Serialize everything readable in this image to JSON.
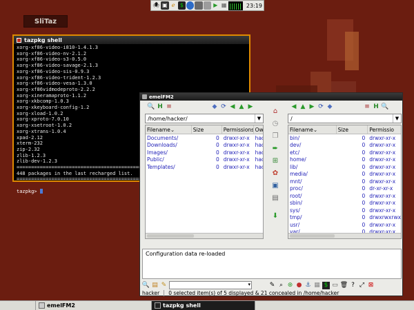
{
  "desktop": {
    "logo_text": "SliTaz"
  },
  "top_panel": {
    "icons": [
      "bug-icon",
      "terminal-icon",
      "browser-icon",
      "globe-icon",
      "folder-icon",
      "play-icon",
      "media-icon",
      "cpu-monitor-icon"
    ],
    "clock": "23:19"
  },
  "terminal": {
    "title": "tazpkg shell",
    "lines": [
      "xorg-xf86-video-i810-1.4.1.3",
      "xorg-xf86-video-nv-2.1.2",
      "xorg-xf86-video-s3-0.5.0",
      "xorg-xf86-video-savage-2.1.3",
      "xorg-xf86-video-sis-0.9.3",
      "xorg-xf86-video-trident-1.2.3",
      "xorg-xf86-video-vesa-1.3.0",
      "xorg-xf86vidmodeproto-2.2.2",
      "xorg-xineramaproto-1.1.2",
      "xorg-xkbcomp-1.0.3",
      "xorg-xkeyboard-config-1.2",
      "xorg-xload-1.0.2",
      "xorg-xproto-7.0.10",
      "xorg-xsetroot-1.0.2",
      "xorg-xtrans-1.0.4",
      "xpad-2.12",
      "xterm-232",
      "zip-2.32",
      "zlib-1.2.3",
      "zlib-dev-1.2.3",
      "================================================",
      "448 packages in the last recharged list.",
      "================================================",
      ""
    ],
    "prompt": "tazpkg> "
  },
  "emelfm": {
    "title": "emelFM2",
    "left": {
      "path": "/home/hacker/",
      "columns": [
        "Filename",
        "Size",
        "Permissions",
        "Owr"
      ],
      "rows": [
        {
          "name": "Documents/",
          "size": "0",
          "perm": "drwxr-xr-x",
          "owner": "hack"
        },
        {
          "name": "Downloads/",
          "size": "0",
          "perm": "drwxr-xr-x",
          "owner": "hack"
        },
        {
          "name": "Images/",
          "size": "0",
          "perm": "drwxr-xr-x",
          "owner": "hack"
        },
        {
          "name": "Public/",
          "size": "0",
          "perm": "drwxr-xr-x",
          "owner": "hack"
        },
        {
          "name": "Templates/",
          "size": "0",
          "perm": "drwxr-xr-x",
          "owner": "hack"
        }
      ]
    },
    "right": {
      "path": "/",
      "columns": [
        "Filename",
        "Size",
        "Permissio"
      ],
      "rows": [
        {
          "name": "bin/",
          "size": "0",
          "perm": "drwxr-xr-x"
        },
        {
          "name": "dev/",
          "size": "0",
          "perm": "drwxr-xr-x"
        },
        {
          "name": "etc/",
          "size": "0",
          "perm": "drwxr-xr-x"
        },
        {
          "name": "home/",
          "size": "0",
          "perm": "drwxr-xr-x"
        },
        {
          "name": "lib/",
          "size": "0",
          "perm": "drwxr-xr-x"
        },
        {
          "name": "media/",
          "size": "0",
          "perm": "drwxr-xr-x"
        },
        {
          "name": "mnt/",
          "size": "0",
          "perm": "drwxr-xr-x"
        },
        {
          "name": "proc/",
          "size": "0",
          "perm": "dr-xr-xr-x"
        },
        {
          "name": "root/",
          "size": "0",
          "perm": "drwxr-xr-x"
        },
        {
          "name": "sbin/",
          "size": "0",
          "perm": "drwxr-xr-x"
        },
        {
          "name": "sys/",
          "size": "0",
          "perm": "drwxr-xr-x"
        },
        {
          "name": "tmp/",
          "size": "0",
          "perm": "drwxrwxrwx"
        },
        {
          "name": "usr/",
          "size": "0",
          "perm": "drwxr-xr-x"
        },
        {
          "name": "var/",
          "size": "0",
          "perm": "drwxr-xr-x"
        }
      ]
    },
    "output": "Configuration data re-loaded",
    "status_user": "hacker",
    "status_text": "0 selected item(s) of 5 displayed & 21 concealed in /home/hacker"
  },
  "taskbar": {
    "tasks": [
      {
        "label": "emelFM2",
        "active": false
      },
      {
        "label": "tazpkg shell",
        "active": true
      }
    ]
  }
}
